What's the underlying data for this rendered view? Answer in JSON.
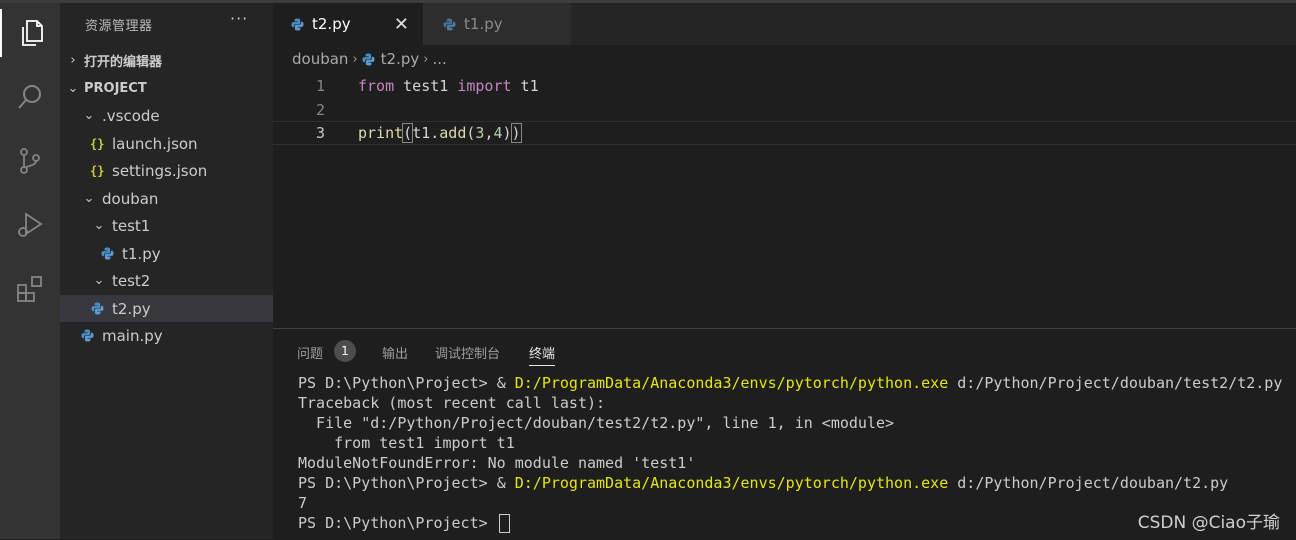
{
  "explorer": {
    "title": "资源管理器",
    "more": "···",
    "open_editors": "打开的编辑器",
    "project_header": "PROJECT",
    "tree": [
      {
        "label": ".vscode",
        "kind": "folder"
      },
      {
        "label": "launch.json",
        "kind": "json"
      },
      {
        "label": "settings.json",
        "kind": "json"
      },
      {
        "label": "douban",
        "kind": "folder"
      },
      {
        "label": "test1",
        "kind": "folder"
      },
      {
        "label": "t1.py",
        "kind": "py"
      },
      {
        "label": "test2",
        "kind": "folder"
      },
      {
        "label": "t2.py",
        "kind": "py",
        "selected": true
      },
      {
        "label": "main.py",
        "kind": "py"
      }
    ],
    "json_glyph": "{}"
  },
  "tabs": [
    {
      "label": "t2.py",
      "active": true,
      "close": "✕"
    },
    {
      "label": "t1.py",
      "active": false
    }
  ],
  "breadcrumb": {
    "folder": "douban",
    "file": "t2.py",
    "tail": "..."
  },
  "editor": {
    "line_numbers": [
      "1",
      "2",
      "3"
    ],
    "line1": {
      "kw1": "from",
      "mod": " test1 ",
      "kw2": "import",
      "name": " t1"
    },
    "line3": {
      "fn": "print",
      "open": "(",
      "obj": "t1",
      "dot": ".",
      "method": "add",
      "open2": "(",
      "n1": "3",
      "comma": ",",
      "n2": "4",
      "close2": ")",
      "close": ")"
    }
  },
  "panel": {
    "tabs": [
      {
        "label": "问题",
        "badge": "1"
      },
      {
        "label": "输出"
      },
      {
        "label": "调试控制台"
      },
      {
        "label": "终端",
        "active": true
      }
    ]
  },
  "terminal": {
    "prompt": "PS D:\\Python\\Project> ",
    "amp": "& ",
    "python_exe": "D:/ProgramData/Anaconda3/envs/pytorch/python.exe",
    "run1_arg": " d:/Python/Project/douban/test2/t2.py",
    "tb1": "Traceback (most recent call last):",
    "tb2": "  File \"d:/Python/Project/douban/test2/t2.py\", line 1, in <module>",
    "tb3": "    from test1 import t1",
    "tb4": "ModuleNotFoundError: No module named 'test1'",
    "run2_arg": " d:/Python/Project/douban/t2.py",
    "output": "7",
    "prompt_final": "PS D:\\Python\\Project> "
  },
  "watermark": "CSDN @Ciao子瑜",
  "colors": {
    "accent": "#e5e510",
    "keyword": "#c586c0",
    "function": "#dcdcaa",
    "number": "#b5cea8"
  }
}
